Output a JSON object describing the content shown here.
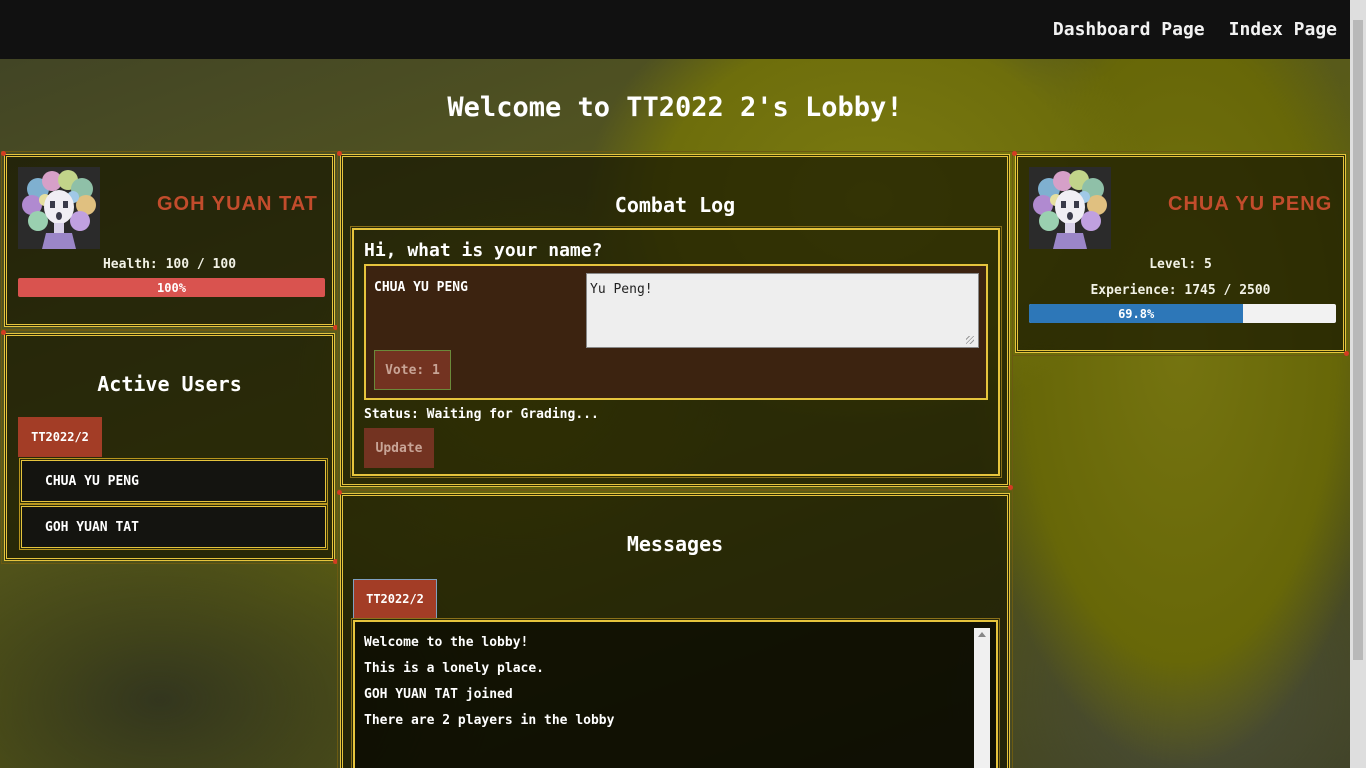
{
  "nav": {
    "dashboard_label": "Dashboard Page",
    "index_label": "Index Page"
  },
  "lobby": {
    "title": "Welcome to TT2022 2's Lobby!"
  },
  "self_player": {
    "name": "GOH YUAN TAT",
    "health_text": "Health: 100 / 100",
    "health_percent_label": "100%",
    "health_fraction": 1.0,
    "health_bar_color": "#d9534f"
  },
  "other_player": {
    "name": "CHUA YU PENG",
    "level_text": "Level: 5",
    "experience_text": "Experience: 1745 / 2500",
    "experience_percent_label": "69.8%",
    "experience_fraction": 0.698,
    "experience_bar_color": "#2d77b8"
  },
  "active_users": {
    "heading": "Active Users",
    "group_tab": "TT2022/2",
    "users": [
      "CHUA YU PENG",
      "GOH YUAN TAT"
    ]
  },
  "combat_log": {
    "heading": "Combat Log",
    "question": "Hi, what is your name?",
    "answer_author": "CHUA YU PENG",
    "answer_text": "Yu Peng!",
    "vote_label": "Vote: 1",
    "status_text": "Status: Waiting for Grading...",
    "update_label": "Update"
  },
  "messages": {
    "heading": "Messages",
    "group_tab": "TT2022/2",
    "lines": [
      "Welcome to the lobby!",
      "This is a lonely place.",
      "GOH YUAN TAT joined",
      "There are 2 players in the lobby"
    ]
  },
  "colors": {
    "accent_gold": "#e6c43d",
    "brand_red": "#a33d26",
    "name_red": "#c24c2c"
  }
}
